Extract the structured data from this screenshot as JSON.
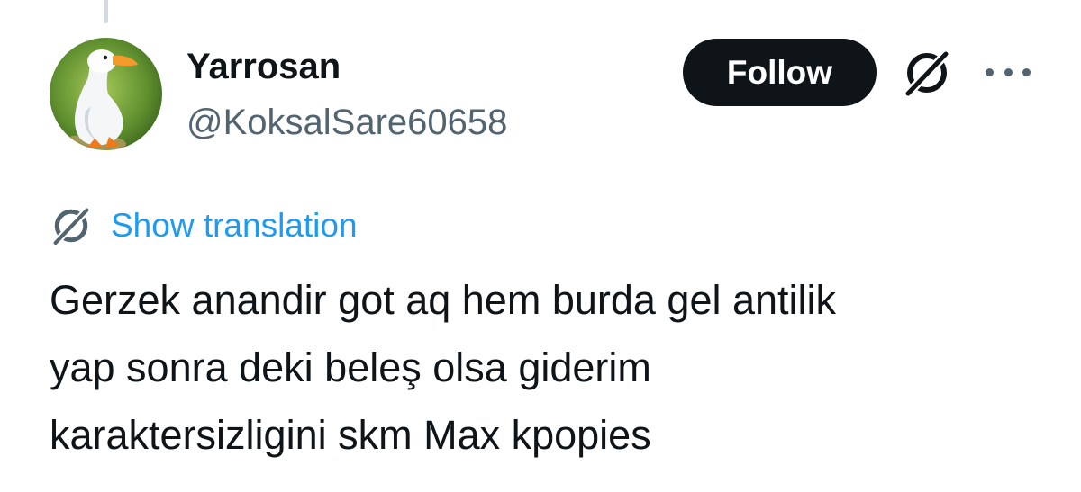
{
  "user": {
    "display_name": "Yarrosan",
    "handle": "@KoksalSare60658",
    "avatar_icon": "duck-avatar"
  },
  "actions": {
    "follow_label": "Follow",
    "grok_icon": "grok-icon",
    "more_icon": "more-icon"
  },
  "translation": {
    "label": "Show translation"
  },
  "tweet": {
    "lines": [
      "Gerzek anandir got aq hem burda gel antilik",
      "yap sonra deki beleş olsa giderim",
      "karaktersizligini skm Max kpopies"
    ]
  },
  "colors": {
    "text": "#0f1419",
    "secondary": "#536471",
    "link": "#1d9bf0",
    "button_bg": "#0f1419",
    "button_text": "#ffffff"
  }
}
